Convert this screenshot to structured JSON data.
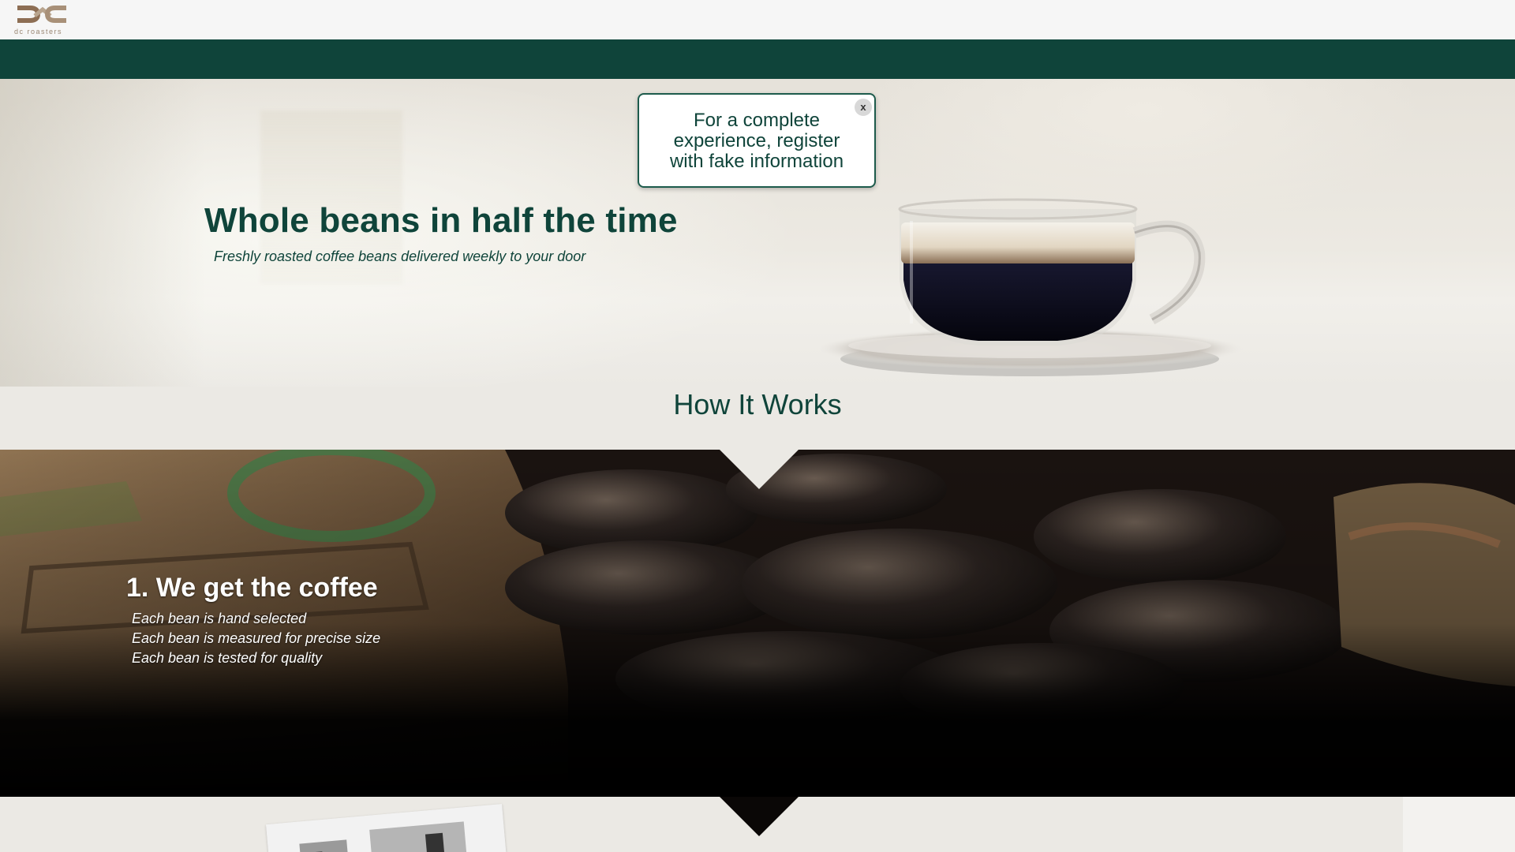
{
  "header": {
    "logo_text": "dc roasters",
    "logo_color": "#8d6e54"
  },
  "hero": {
    "title": "Whole beans in half the time",
    "subtitle": "Freshly roasted coffee beans delivered weekly to your door"
  },
  "popup": {
    "message": "For a complete experience, register with fake information",
    "close_label": "x"
  },
  "how_it_works": {
    "title": "How It Works",
    "steps": [
      {
        "title": "1. We get the coffee",
        "items": [
          "Each bean is hand selected",
          "Each bean is measured for precise size",
          "Each bean is tested for quality"
        ]
      }
    ]
  },
  "colors": {
    "brand_green": "#0f443a",
    "background": "#ebe9e4",
    "header_bg": "#f6f6f6"
  }
}
